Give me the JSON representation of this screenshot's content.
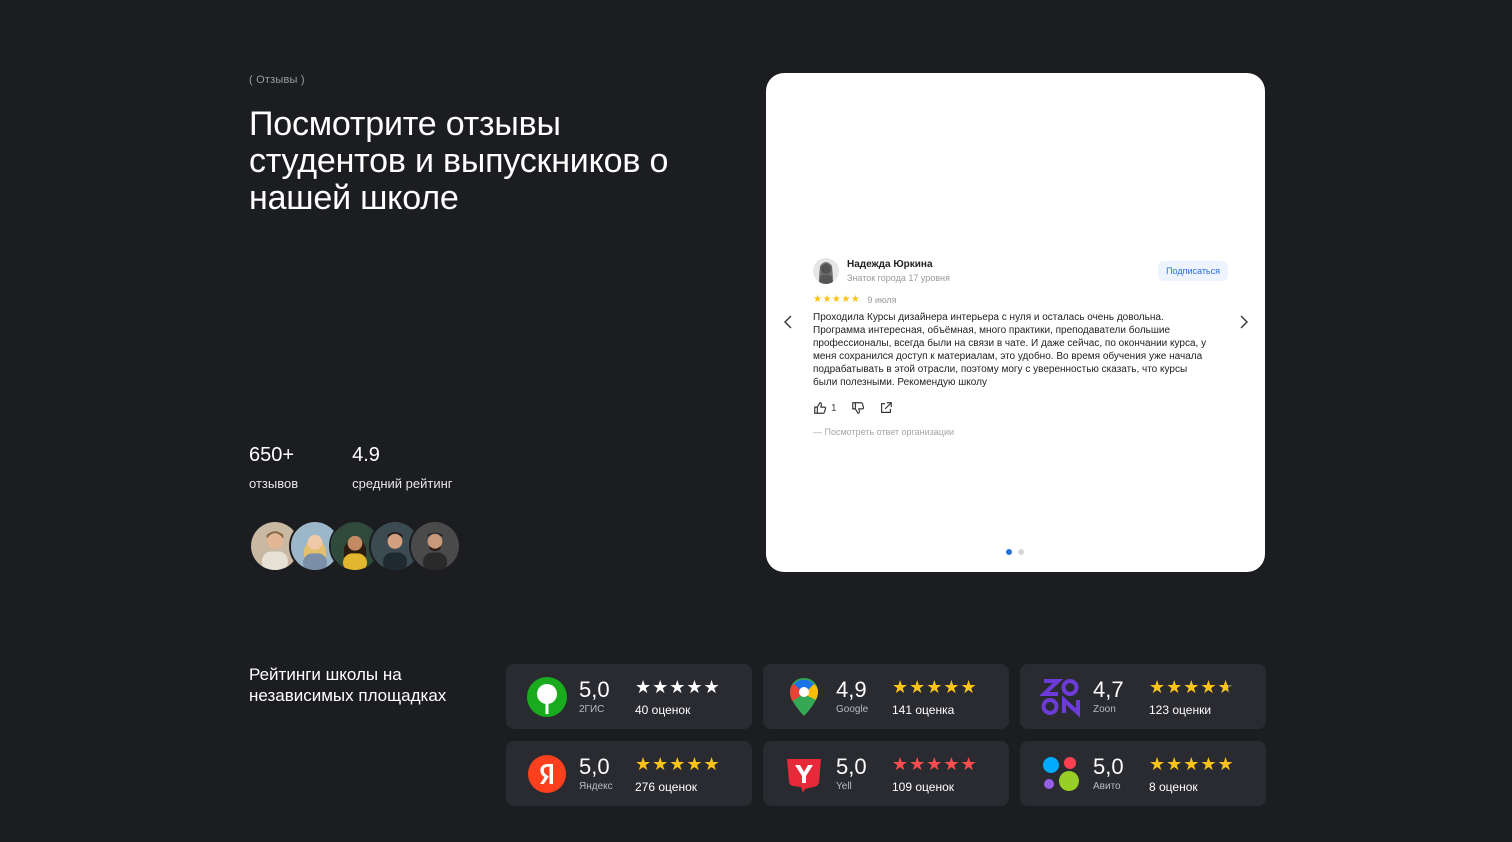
{
  "section": {
    "tag": "( Отзывы )",
    "headline": "Посмотрите отзывы студентов и выпускников о нашей школе"
  },
  "stats": [
    {
      "value": "650+",
      "label": "отзывов"
    },
    {
      "value": "4.9",
      "label": "средний рейтинг"
    }
  ],
  "review": {
    "author": "Надежда Юркина",
    "level": "Знаток города 17 уровня",
    "subscribe_label": "Подписаться",
    "stars": "★★★★★",
    "date": "9 июля",
    "text": "Проходила Курсы дизайнера интерьера с нуля и осталась очень довольна. Программа интересная, объёмная, много практики, преподаватели большие профессионалы, всегда были на связи в чате. И даже сейчас, по окончании курса, у меня сохранился доступ к материалам, это удобно. Во время обучения уже начала подрабатывать в этой отрасли, поэтому могу с уверенностью сказать, что курсы были полезными. Рекомендую школу",
    "likes": "1",
    "reply_link": "— Посмотреть ответ организации",
    "slides_total": 2,
    "slide_active": 1
  },
  "ratings": {
    "title": "Рейтинги школы на независимых площадках",
    "platforms": [
      {
        "name": "2ГИС",
        "score": "5,0",
        "stars": "★★★★★",
        "count": "40 оценок",
        "icon": "2gis-logo-icon",
        "star_color": "white"
      },
      {
        "name": "Google",
        "score": "4,9",
        "stars": "★★★★★",
        "count": "141 оценка",
        "icon": "google-maps-logo-icon",
        "star_color": "yellow"
      },
      {
        "name": "Zoon",
        "score": "4,7",
        "stars": "★★★★",
        "count": "123 оценки",
        "icon": "zoon-logo-icon",
        "star_color": "yellow",
        "partial_star": "★",
        "partial_fraction": 0.6
      },
      {
        "name": "Яндекс",
        "score": "5,0",
        "stars": "★★★★★",
        "count": "276 оценок",
        "icon": "yandex-logo-icon",
        "star_color": "yellow"
      },
      {
        "name": "Yell",
        "score": "5,0",
        "stars": "★★★★★",
        "count": "109 оценок",
        "icon": "yell-logo-icon",
        "star_color": "red"
      },
      {
        "name": "Авито",
        "score": "5,0",
        "stars": "★★★★★",
        "count": "8 оценок",
        "icon": "avito-logo-icon",
        "star_color": "yellow"
      }
    ]
  },
  "colors": {
    "background": "#1c1d21",
    "card": "#2a2b30",
    "accent_blue": "#2a70d8",
    "star_yellow": "#fcc419",
    "star_red": "#ff4d4f"
  }
}
